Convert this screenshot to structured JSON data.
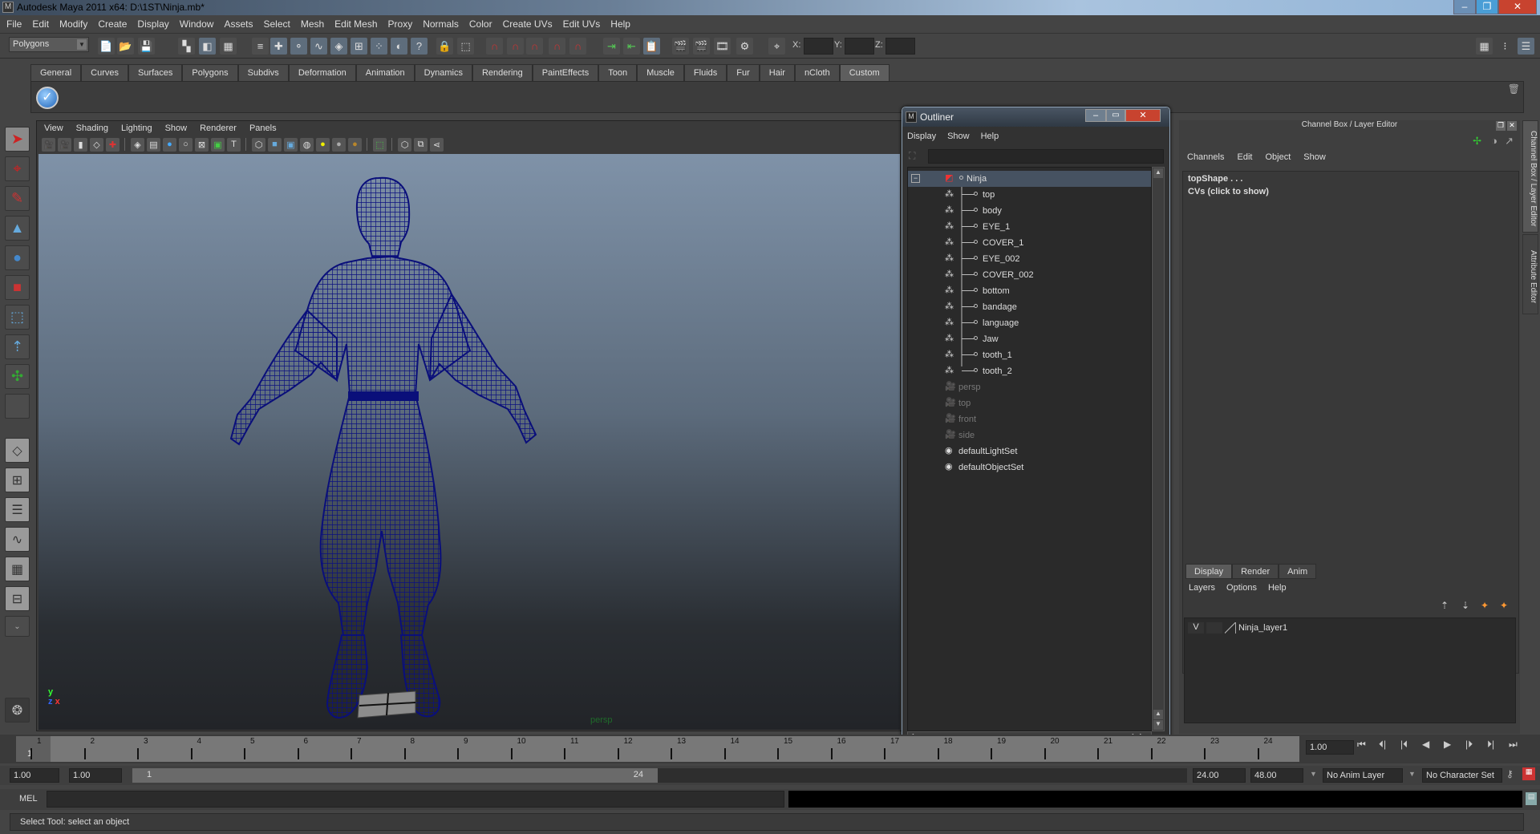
{
  "window": {
    "title": "Autodesk Maya 2011 x64: D:\\1ST\\Ninja.mb*",
    "controls": [
      "minimize",
      "restore",
      "close"
    ]
  },
  "menubar": [
    "File",
    "Edit",
    "Modify",
    "Create",
    "Display",
    "Window",
    "Assets",
    "Select",
    "Mesh",
    "Edit Mesh",
    "Proxy",
    "Normals",
    "Color",
    "Create UVs",
    "Edit UVs",
    "Help"
  ],
  "statusline": {
    "mode": "Polygons",
    "coord_labels": {
      "x": "X:",
      "y": "Y:",
      "z": "Z:"
    },
    "coord_values": {
      "x": "",
      "y": "",
      "z": ""
    }
  },
  "shelf": {
    "tabs": [
      "General",
      "Curves",
      "Surfaces",
      "Polygons",
      "Subdivs",
      "Deformation",
      "Animation",
      "Dynamics",
      "Rendering",
      "PaintEffects",
      "Toon",
      "Muscle",
      "Fluids",
      "Fur",
      "Hair",
      "nCloth",
      "Custom"
    ],
    "active_tab": "Custom",
    "items": [
      {
        "icon": "checkmark-icon"
      }
    ]
  },
  "toolbox": {
    "tools": [
      {
        "name": "select-tool",
        "glyph": "➤",
        "active": true
      },
      {
        "name": "lasso-tool",
        "glyph": "⌖"
      },
      {
        "name": "paint-select-tool",
        "glyph": "✎"
      },
      {
        "name": "move-tool",
        "glyph": "▲"
      },
      {
        "name": "rotate-tool",
        "glyph": "●"
      },
      {
        "name": "scale-tool",
        "glyph": "■"
      },
      {
        "name": "universal-manipulator",
        "glyph": "⬚"
      },
      {
        "name": "soft-modification-tool",
        "glyph": "⇡"
      },
      {
        "name": "show-manipulator-tool",
        "glyph": "✣"
      },
      {
        "name": "last-used-tool",
        "glyph": ""
      }
    ],
    "layouts": [
      "single-perspective-layout",
      "four-view-layout",
      "outliner-persp-layout",
      "persp-graph-layout",
      "hypershade-persp-layout",
      "persp-graph-hypergraph-layout"
    ]
  },
  "viewport": {
    "menu": [
      "View",
      "Shading",
      "Lighting",
      "Show",
      "Renderer",
      "Panels"
    ],
    "camera": "persp",
    "axis": {
      "y": "y",
      "x": "x",
      "z": "z"
    },
    "wireframe_color": "#0a0f7a"
  },
  "outliner": {
    "title": "Outliner",
    "menu": [
      "Display",
      "Show",
      "Help"
    ],
    "search": "",
    "items": [
      {
        "label": "Ninja",
        "icon": "group-transform-icon",
        "indent": 0,
        "expanded": true,
        "selected": true
      },
      {
        "label": "top",
        "icon": "mesh-icon",
        "indent": 1
      },
      {
        "label": "body",
        "icon": "mesh-icon",
        "indent": 1
      },
      {
        "label": "EYE_1",
        "icon": "mesh-icon",
        "indent": 1
      },
      {
        "label": "COVER_1",
        "icon": "mesh-icon",
        "indent": 1
      },
      {
        "label": "EYE_002",
        "icon": "mesh-icon",
        "indent": 1
      },
      {
        "label": "COVER_002",
        "icon": "mesh-icon",
        "indent": 1
      },
      {
        "label": "bottom",
        "icon": "mesh-icon",
        "indent": 1
      },
      {
        "label": "bandage",
        "icon": "mesh-icon",
        "indent": 1
      },
      {
        "label": "language",
        "icon": "mesh-icon",
        "indent": 1
      },
      {
        "label": "Jaw",
        "icon": "mesh-icon",
        "indent": 1
      },
      {
        "label": "tooth_1",
        "icon": "mesh-icon",
        "indent": 1
      },
      {
        "label": "tooth_2",
        "icon": "mesh-icon",
        "indent": 1,
        "last": true
      },
      {
        "label": "persp",
        "icon": "camera-icon",
        "indent": 0,
        "dim": true
      },
      {
        "label": "top",
        "icon": "camera-icon",
        "indent": 0,
        "dim": true
      },
      {
        "label": "front",
        "icon": "camera-icon",
        "indent": 0,
        "dim": true
      },
      {
        "label": "side",
        "icon": "camera-icon",
        "indent": 0,
        "dim": true
      },
      {
        "label": "defaultLightSet",
        "icon": "set-icon",
        "indent": 0
      },
      {
        "label": "defaultObjectSet",
        "icon": "set-icon",
        "indent": 0
      }
    ]
  },
  "channelbox": {
    "header": "Channel Box / Layer Editor",
    "menu": [
      "Channels",
      "Edit",
      "Object",
      "Show"
    ],
    "lines": [
      "topShape . . .",
      "CVs (click to show)"
    ],
    "side_tabs": [
      "Channel Box / Layer Editor",
      "Attribute Editor"
    ]
  },
  "layers": {
    "tabs": [
      "Display",
      "Render",
      "Anim"
    ],
    "active_tab": "Display",
    "menu": [
      "Layers",
      "Options",
      "Help"
    ],
    "rows": [
      {
        "visible": "V",
        "name": "Ninja_layer1"
      }
    ]
  },
  "timeslider": {
    "ticks": [
      "1",
      "2",
      "3",
      "4",
      "5",
      "6",
      "7",
      "8",
      "9",
      "10",
      "11",
      "12",
      "13",
      "14",
      "15",
      "16",
      "17",
      "18",
      "19",
      "20",
      "21",
      "22",
      "23",
      "24"
    ],
    "current_marker": "1",
    "current_frame": "1.00"
  },
  "playback": [
    "go-to-start",
    "step-back-frame",
    "step-back-key",
    "play-backwards",
    "play-forwards",
    "step-forward-key",
    "step-forward-frame",
    "go-to-end"
  ],
  "range": {
    "start_time": "1.00",
    "playback_start": "1.00",
    "slider_start": "1",
    "slider_end": "24",
    "playback_end": "24.00",
    "end_time": "48.00",
    "anim_layer": "No Anim Layer",
    "character_set": "No Character Set"
  },
  "mel": {
    "label": "MEL",
    "input": "",
    "output": ""
  },
  "helpline": "Select Tool: select an object"
}
